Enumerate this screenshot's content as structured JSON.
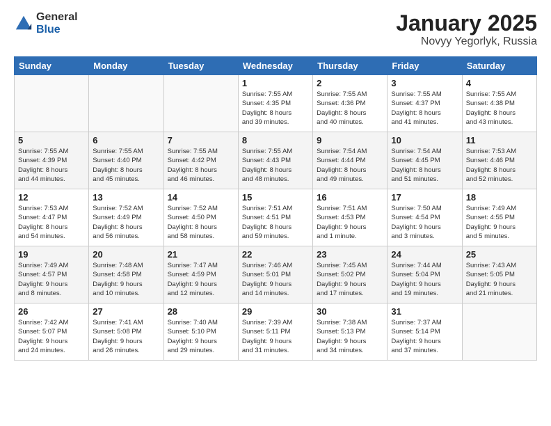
{
  "logo": {
    "general": "General",
    "blue": "Blue"
  },
  "title": "January 2025",
  "location": "Novyy Yegorlyk, Russia",
  "weekdays": [
    "Sunday",
    "Monday",
    "Tuesday",
    "Wednesday",
    "Thursday",
    "Friday",
    "Saturday"
  ],
  "weeks": [
    [
      {
        "day": "",
        "info": ""
      },
      {
        "day": "",
        "info": ""
      },
      {
        "day": "",
        "info": ""
      },
      {
        "day": "1",
        "info": "Sunrise: 7:55 AM\nSunset: 4:35 PM\nDaylight: 8 hours\nand 39 minutes."
      },
      {
        "day": "2",
        "info": "Sunrise: 7:55 AM\nSunset: 4:36 PM\nDaylight: 8 hours\nand 40 minutes."
      },
      {
        "day": "3",
        "info": "Sunrise: 7:55 AM\nSunset: 4:37 PM\nDaylight: 8 hours\nand 41 minutes."
      },
      {
        "day": "4",
        "info": "Sunrise: 7:55 AM\nSunset: 4:38 PM\nDaylight: 8 hours\nand 43 minutes."
      }
    ],
    [
      {
        "day": "5",
        "info": "Sunrise: 7:55 AM\nSunset: 4:39 PM\nDaylight: 8 hours\nand 44 minutes."
      },
      {
        "day": "6",
        "info": "Sunrise: 7:55 AM\nSunset: 4:40 PM\nDaylight: 8 hours\nand 45 minutes."
      },
      {
        "day": "7",
        "info": "Sunrise: 7:55 AM\nSunset: 4:42 PM\nDaylight: 8 hours\nand 46 minutes."
      },
      {
        "day": "8",
        "info": "Sunrise: 7:55 AM\nSunset: 4:43 PM\nDaylight: 8 hours\nand 48 minutes."
      },
      {
        "day": "9",
        "info": "Sunrise: 7:54 AM\nSunset: 4:44 PM\nDaylight: 8 hours\nand 49 minutes."
      },
      {
        "day": "10",
        "info": "Sunrise: 7:54 AM\nSunset: 4:45 PM\nDaylight: 8 hours\nand 51 minutes."
      },
      {
        "day": "11",
        "info": "Sunrise: 7:53 AM\nSunset: 4:46 PM\nDaylight: 8 hours\nand 52 minutes."
      }
    ],
    [
      {
        "day": "12",
        "info": "Sunrise: 7:53 AM\nSunset: 4:47 PM\nDaylight: 8 hours\nand 54 minutes."
      },
      {
        "day": "13",
        "info": "Sunrise: 7:52 AM\nSunset: 4:49 PM\nDaylight: 8 hours\nand 56 minutes."
      },
      {
        "day": "14",
        "info": "Sunrise: 7:52 AM\nSunset: 4:50 PM\nDaylight: 8 hours\nand 58 minutes."
      },
      {
        "day": "15",
        "info": "Sunrise: 7:51 AM\nSunset: 4:51 PM\nDaylight: 8 hours\nand 59 minutes."
      },
      {
        "day": "16",
        "info": "Sunrise: 7:51 AM\nSunset: 4:53 PM\nDaylight: 9 hours\nand 1 minute."
      },
      {
        "day": "17",
        "info": "Sunrise: 7:50 AM\nSunset: 4:54 PM\nDaylight: 9 hours\nand 3 minutes."
      },
      {
        "day": "18",
        "info": "Sunrise: 7:49 AM\nSunset: 4:55 PM\nDaylight: 9 hours\nand 5 minutes."
      }
    ],
    [
      {
        "day": "19",
        "info": "Sunrise: 7:49 AM\nSunset: 4:57 PM\nDaylight: 9 hours\nand 8 minutes."
      },
      {
        "day": "20",
        "info": "Sunrise: 7:48 AM\nSunset: 4:58 PM\nDaylight: 9 hours\nand 10 minutes."
      },
      {
        "day": "21",
        "info": "Sunrise: 7:47 AM\nSunset: 4:59 PM\nDaylight: 9 hours\nand 12 minutes."
      },
      {
        "day": "22",
        "info": "Sunrise: 7:46 AM\nSunset: 5:01 PM\nDaylight: 9 hours\nand 14 minutes."
      },
      {
        "day": "23",
        "info": "Sunrise: 7:45 AM\nSunset: 5:02 PM\nDaylight: 9 hours\nand 17 minutes."
      },
      {
        "day": "24",
        "info": "Sunrise: 7:44 AM\nSunset: 5:04 PM\nDaylight: 9 hours\nand 19 minutes."
      },
      {
        "day": "25",
        "info": "Sunrise: 7:43 AM\nSunset: 5:05 PM\nDaylight: 9 hours\nand 21 minutes."
      }
    ],
    [
      {
        "day": "26",
        "info": "Sunrise: 7:42 AM\nSunset: 5:07 PM\nDaylight: 9 hours\nand 24 minutes."
      },
      {
        "day": "27",
        "info": "Sunrise: 7:41 AM\nSunset: 5:08 PM\nDaylight: 9 hours\nand 26 minutes."
      },
      {
        "day": "28",
        "info": "Sunrise: 7:40 AM\nSunset: 5:10 PM\nDaylight: 9 hours\nand 29 minutes."
      },
      {
        "day": "29",
        "info": "Sunrise: 7:39 AM\nSunset: 5:11 PM\nDaylight: 9 hours\nand 31 minutes."
      },
      {
        "day": "30",
        "info": "Sunrise: 7:38 AM\nSunset: 5:13 PM\nDaylight: 9 hours\nand 34 minutes."
      },
      {
        "day": "31",
        "info": "Sunrise: 7:37 AM\nSunset: 5:14 PM\nDaylight: 9 hours\nand 37 minutes."
      },
      {
        "day": "",
        "info": ""
      }
    ]
  ]
}
